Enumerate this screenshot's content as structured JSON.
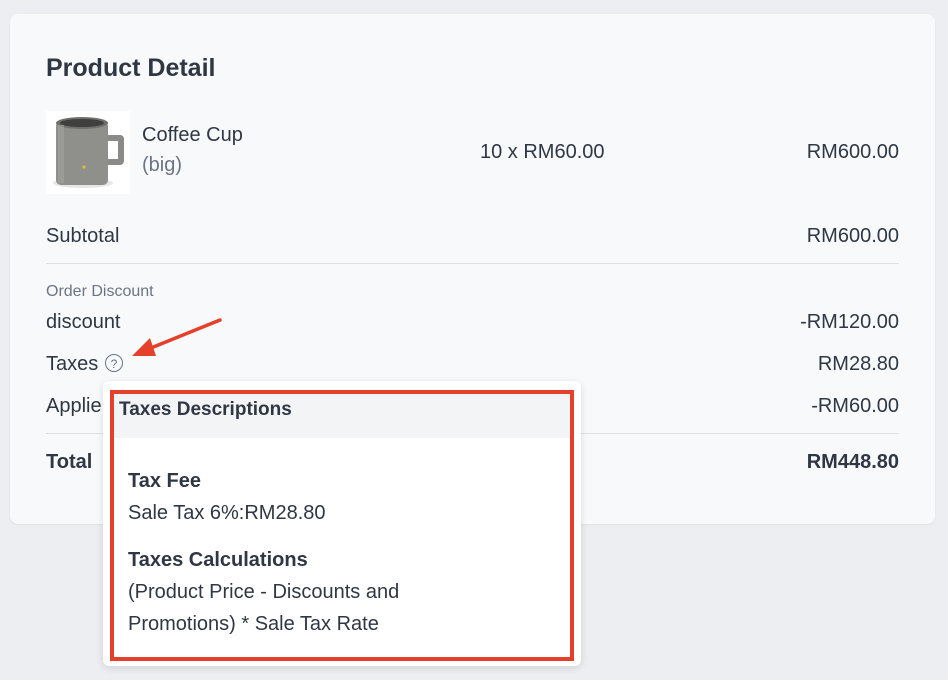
{
  "card": {
    "title": "Product Detail"
  },
  "product": {
    "name": "Coffee Cup",
    "variant": "(big)",
    "qty_price": "10 x RM60.00",
    "total": "RM600.00",
    "image_icon": "coffee-mug"
  },
  "subtotal": {
    "label": "Subtotal",
    "value": "RM600.00"
  },
  "order_discount": {
    "caption": "Order Discount",
    "label": "discount",
    "value": "-RM120.00"
  },
  "taxes": {
    "label": "Taxes",
    "help_glyph": "?",
    "value": "RM28.80"
  },
  "applied": {
    "label": "Applie",
    "value": "-RM60.00"
  },
  "total": {
    "label": "Total",
    "value": "RM448.80"
  },
  "tooltip": {
    "title": "Taxes Descriptions",
    "tax_fee_heading": "Tax Fee",
    "tax_fee_line": "Sale Tax 6%:RM28.80",
    "calc_heading": "Taxes Calculations",
    "calc_line1": "(Product Price - Discounts and",
    "calc_line2": "Promotions) * Sale Tax Rate"
  },
  "colors": {
    "annotation_red": "#e5402c",
    "text": "#2f3744",
    "muted": "#6b7484"
  }
}
